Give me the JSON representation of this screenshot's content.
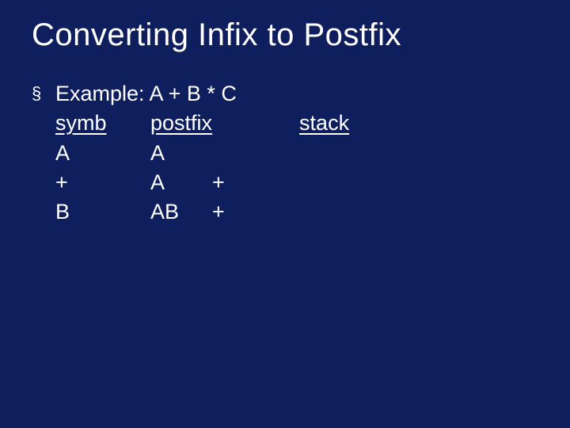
{
  "title": "Converting Infix to Postfix",
  "bullet_marker": "§",
  "example_label": "Example: A + B * C",
  "headers": {
    "symb": "symb",
    "postfix": "postfix",
    "stack": "stack"
  },
  "rows": [
    {
      "symb": "A",
      "postfix_a": "A",
      "postfix_b": "",
      "stack": ""
    },
    {
      "symb": "+",
      "postfix_a": "A",
      "postfix_b": "+",
      "stack": ""
    },
    {
      "symb": "B",
      "postfix_a": "AB",
      "postfix_b": "+",
      "stack": ""
    }
  ]
}
